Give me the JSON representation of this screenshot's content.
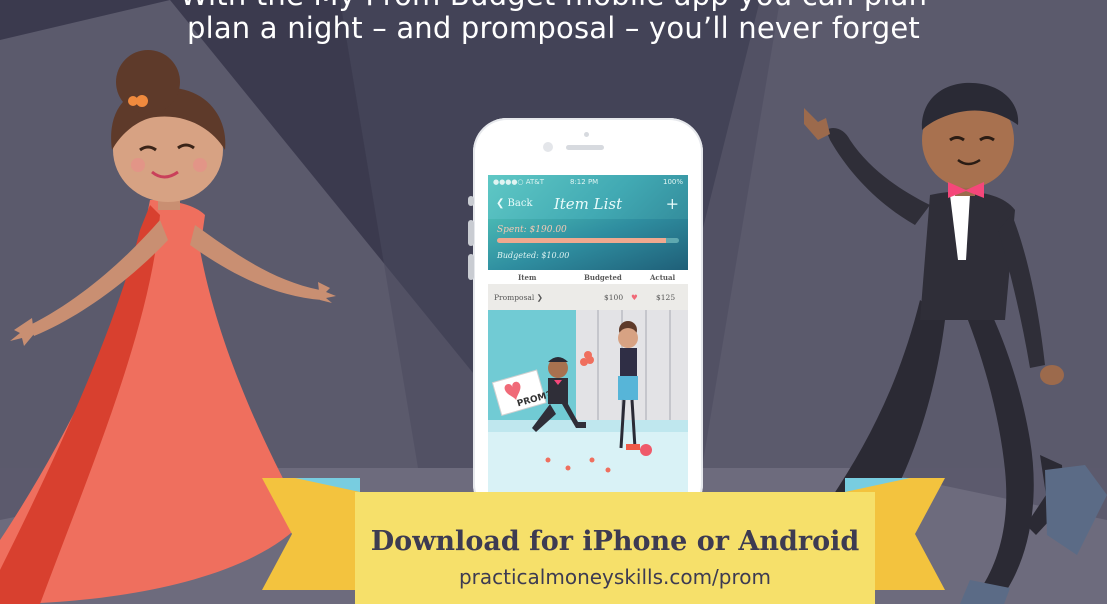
{
  "headline": {
    "line1": "With the My Prom Budget mobile app you can plan",
    "line2": "plan a night – and promposal – you’ll never forget"
  },
  "colors": {
    "background": "#3b3a4e",
    "spotlight": "#5b5a6c",
    "stage_floor": "#6d6b7d",
    "dress": "#ef6f5e",
    "bowtie": "#f5477a",
    "banner": "#f6e06a",
    "banner_text": "#3d3b52",
    "app_teal": "#41a9b3"
  },
  "app": {
    "status": {
      "carrier": "●●●●○ AT&T",
      "time": "8:12 PM",
      "battery": "100%"
    },
    "nav": {
      "back_label": "❮ Back",
      "title": "Item List",
      "add_label": "+"
    },
    "budget": {
      "spent_label": "Spent: $190.00",
      "budgeted_label": "Budgeted: $10.00",
      "progress": 0.93
    },
    "table": {
      "headers": [
        "Item",
        "Budgeted",
        "Actual"
      ],
      "rows": [
        {
          "item": "Promposal ❯",
          "budgeted": "$100",
          "actual": "$125"
        }
      ]
    },
    "illustration": {
      "sign_text": "PROM?"
    }
  },
  "banner": {
    "title": "Download for iPhone or Android",
    "url": "practicalmoneyskills.com/prom"
  }
}
